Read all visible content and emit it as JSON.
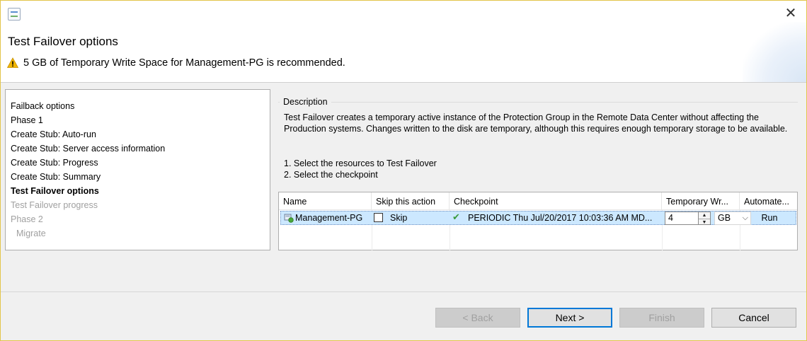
{
  "window": {
    "title": "Test Failover  options",
    "warning": "5 GB of Temporary Write Space for Management-PG is recommended.",
    "close_glyph": "✕"
  },
  "steps": [
    {
      "label": "Failback options",
      "state": "normal"
    },
    {
      "label": "Phase 1",
      "state": "normal"
    },
    {
      "label": "Create Stub: Auto-run",
      "state": "normal"
    },
    {
      "label": "Create Stub: Server access information",
      "state": "normal"
    },
    {
      "label": "Create Stub: Progress",
      "state": "normal"
    },
    {
      "label": "Create Stub: Summary",
      "state": "normal"
    },
    {
      "label": "Test Failover  options",
      "state": "active"
    },
    {
      "label": "Test Failover  progress",
      "state": "disabled"
    },
    {
      "label": "Phase 2",
      "state": "disabled"
    },
    {
      "label": "Migrate",
      "state": "disabled"
    }
  ],
  "description": {
    "legend": "Description",
    "text": "Test Failover creates a temporary active instance of the Protection Group in the Remote Data Center without affecting the Production systems. Changes written to the disk are temporary, although this requires enough temporary storage to be available.",
    "step1": "1. Select the resources to Test Failover",
    "step2": "2. Select the checkpoint"
  },
  "table": {
    "headers": {
      "name": "Name",
      "skip": "Skip this action",
      "checkpoint": "Checkpoint",
      "temp": "Temporary Wr...",
      "auto": "Automate..."
    },
    "row": {
      "name": "Management-PG",
      "skip_label": "Skip",
      "skip_checked": false,
      "checkpoint": "PERIODIC Thu Jul/20/2017 10:03:36 AM MD...",
      "temp_value": "4",
      "unit": "GB",
      "automate": "Run"
    }
  },
  "buttons": {
    "back": "< Back",
    "next": "Next >",
    "finish": "Finish",
    "cancel": "Cancel"
  },
  "colors": {
    "selection": "#cce8ff",
    "warning": "#f2b600",
    "check": "#3a9a3a",
    "default_button_border": "#0078d7"
  }
}
